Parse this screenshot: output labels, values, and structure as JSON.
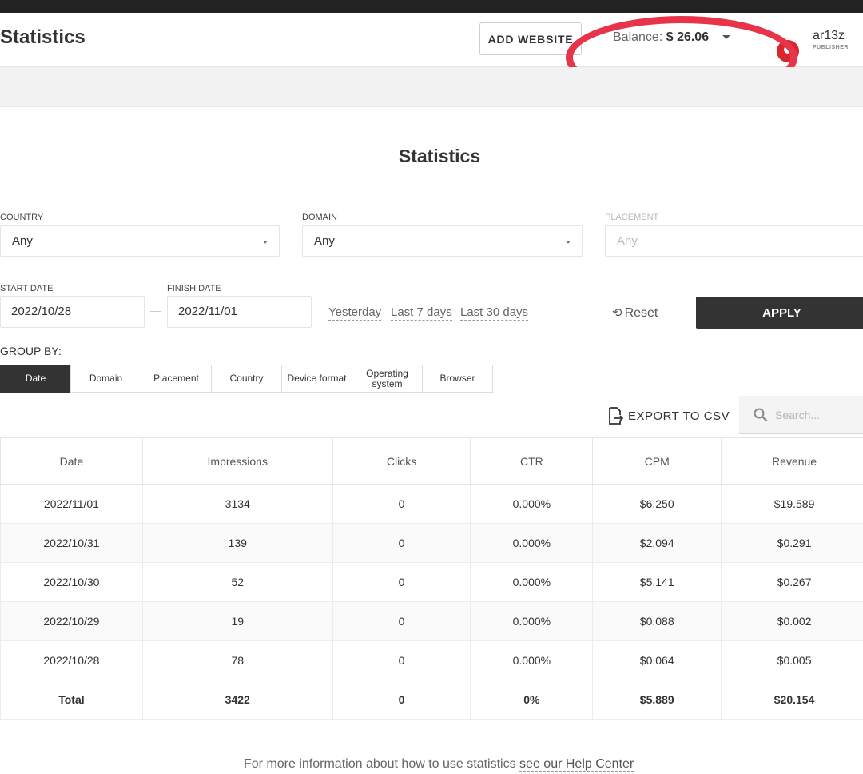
{
  "header": {
    "title": "Statistics",
    "add_website_label": "ADD WEBSITE",
    "balance_label": "Balance:",
    "balance_amount": "$ 26.06",
    "username": "ar13z",
    "user_role": "PUBLISHER",
    "highlight_color": "#e8344b"
  },
  "page": {
    "title": "Statistics"
  },
  "filters": {
    "country": {
      "label": "COUNTRY",
      "value": "Any"
    },
    "domain": {
      "label": "DOMAIN",
      "value": "Any"
    },
    "placement": {
      "label": "PLACEMENT",
      "placeholder": "Any"
    },
    "start_date": {
      "label": "START DATE",
      "value": "2022/10/28"
    },
    "finish_date": {
      "label": "FINISH DATE",
      "value": "2022/11/01"
    },
    "quick_ranges": [
      "Yesterday",
      "Last 7 days",
      "Last 30 days"
    ],
    "reset_label": "Reset",
    "apply_label": "APPLY"
  },
  "group_by": {
    "label": "GROUP BY:",
    "options": [
      "Date",
      "Domain",
      "Placement",
      "Country",
      "Device format",
      "Operating system",
      "Browser"
    ],
    "active": "Date"
  },
  "toolbar": {
    "export_label": "EXPORT TO CSV",
    "search_placeholder": "Search..."
  },
  "table": {
    "columns": [
      "Date",
      "Impressions",
      "Clicks",
      "CTR",
      "CPM",
      "Revenue"
    ],
    "rows": [
      [
        "2022/11/01",
        "3134",
        "0",
        "0.000%",
        "$6.250",
        "$19.589"
      ],
      [
        "2022/10/31",
        "139",
        "0",
        "0.000%",
        "$2.094",
        "$0.291"
      ],
      [
        "2022/10/30",
        "52",
        "0",
        "0.000%",
        "$5.141",
        "$0.267"
      ],
      [
        "2022/10/29",
        "19",
        "0",
        "0.000%",
        "$0.088",
        "$0.002"
      ],
      [
        "2022/10/28",
        "78",
        "0",
        "0.000%",
        "$0.064",
        "$0.005"
      ]
    ],
    "total": [
      "Total",
      "3422",
      "0",
      "0%",
      "$5.889",
      "$20.154"
    ]
  },
  "footer": {
    "text": "For more information about how to use statistics",
    "link_label": "see our Help Center"
  },
  "colors": {
    "primary_dark": "#333333",
    "brand_red": "#d8262c"
  }
}
